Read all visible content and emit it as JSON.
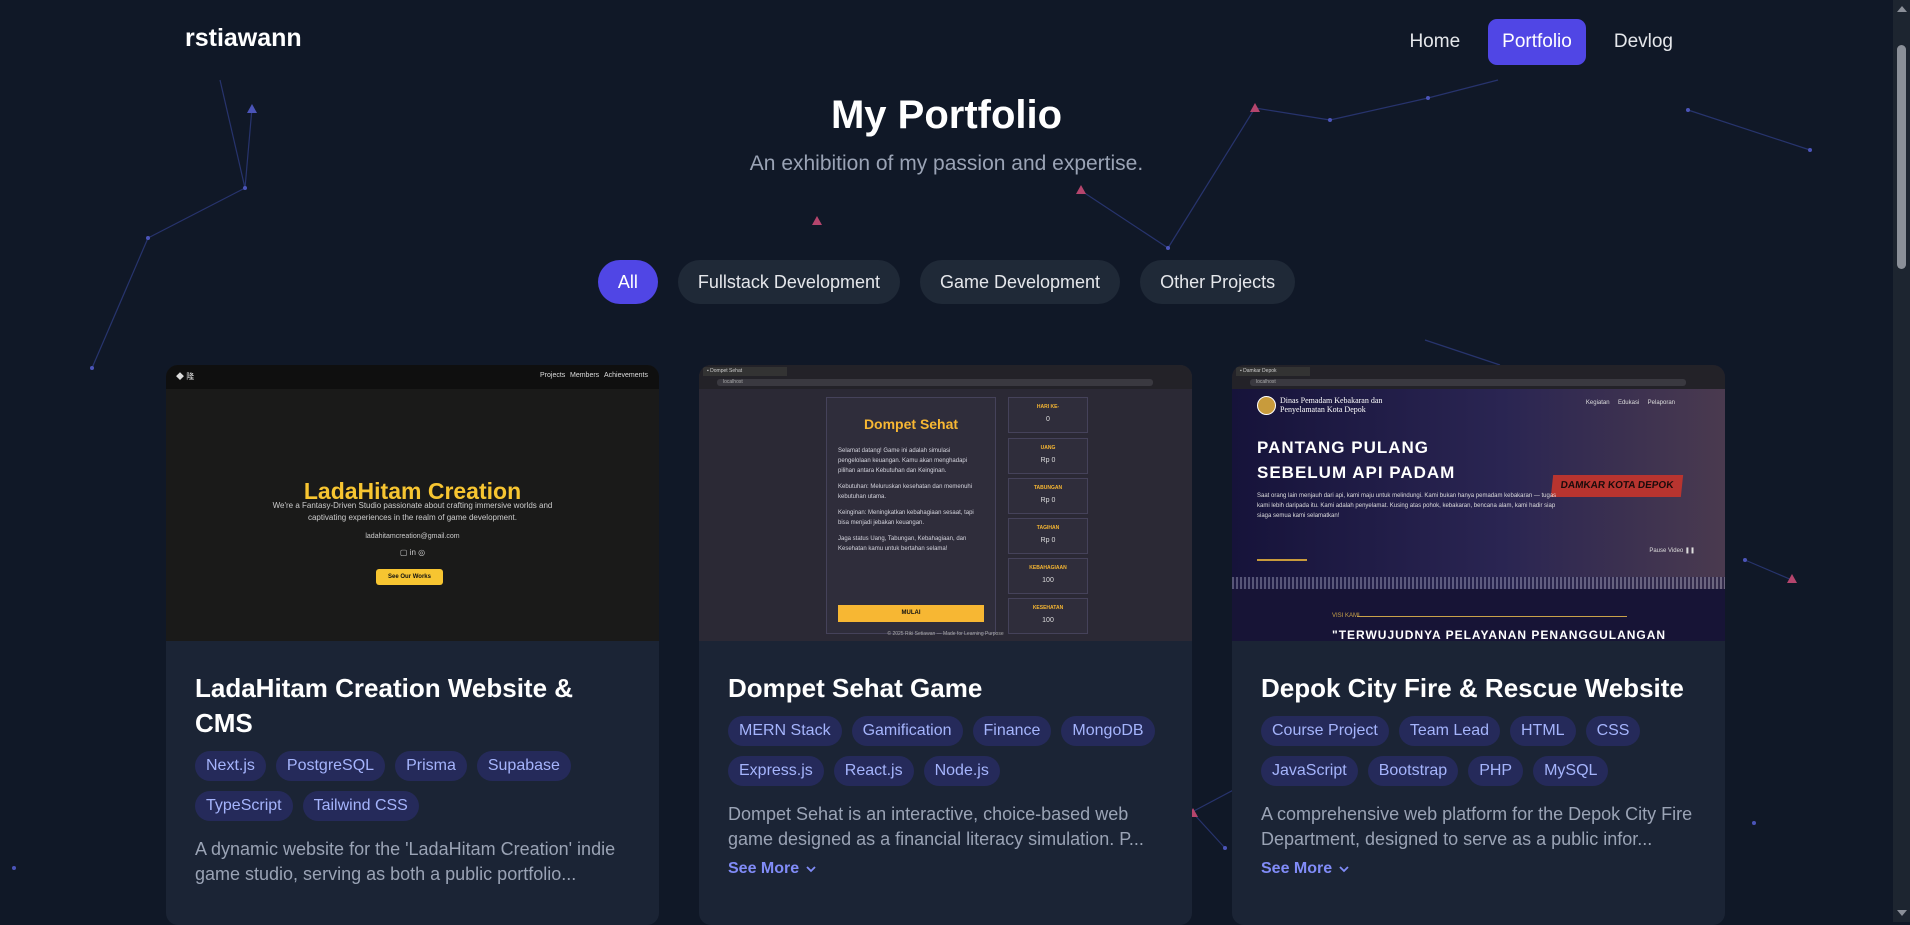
{
  "brand": "rstiawann",
  "nav": {
    "items": [
      "Home",
      "Portfolio",
      "Devlog"
    ],
    "active": "Portfolio"
  },
  "hero": {
    "title": "My Portfolio",
    "subtitle": "An exhibition of my passion and expertise."
  },
  "filters": [
    "All",
    "Fullstack Development",
    "Game Development",
    "Other Projects"
  ],
  "colors": {
    "accent": "#5046e5",
    "background": "#101827",
    "card": "#1b2435",
    "tag_text": "#a5b4fc",
    "link": "#818cf8"
  },
  "cards": [
    {
      "title": "LadaHitam Creation Website & CMS",
      "tags": [
        "Next.js",
        "PostgreSQL",
        "Prisma",
        "Supabase",
        "TypeScript",
        "Tailwind CSS"
      ],
      "description": "A dynamic website for the 'LadaHitam Creation' indie game studio, serving as both a public portfolio...",
      "preview": {
        "nav_links": [
          "Projects",
          "Members",
          "Achievements"
        ],
        "heading": "LadaHitam Creation",
        "text": "We're a Fantasy-Driven Studio passionate about crafting immersive worlds and captivating experiences in the realm of game development.",
        "email": "ladahitamcreation@gmail.com",
        "social": "in",
        "button": "See Our Works"
      }
    },
    {
      "title": "Dompet Sehat Game",
      "tags": [
        "MERN Stack",
        "Gamification",
        "Finance",
        "MongoDB",
        "Express.js",
        "React.js",
        "Node.js"
      ],
      "description": "Dompet Sehat is an interactive, choice-based web game designed as a financial literacy simulation. P...",
      "see_more": "See More",
      "preview": {
        "heading": "Dompet Sehat",
        "paragraphs": [
          "Selamat datang! Game ini adalah simulasi pengelolaan keuangan. Kamu akan menghadapi pilihan antara Kebutuhan dan Keinginan.",
          "Kebutuhan: Meluruskan kesehatan dan memenuhi kebutuhan utama.",
          "Keinginan: Meningkatkan kebahagiaan sesaat, tapi bisa menjadi jebakan keuangan.",
          "Jaga status Uang, Tabungan, Kebahagiaan, dan Kesehatan kamu untuk bertahan selama!"
        ],
        "button": "MULAI",
        "stats": [
          {
            "label": "HARI KE-",
            "value": "0"
          },
          {
            "label": "UANG",
            "value": "Rp 0"
          },
          {
            "label": "TABUNGAN",
            "value": "Rp 0"
          },
          {
            "label": "TAGIHAN",
            "value": "Rp 0"
          },
          {
            "label": "KEBAHAGIAAN",
            "value": "100"
          },
          {
            "label": "KESEHATAN",
            "value": "100"
          }
        ],
        "footer": "© 2025 Riki Setiawan — Made for Learning Purpose"
      }
    },
    {
      "title": "Depok City Fire & Rescue Website",
      "tags": [
        "Course Project",
        "Team Lead",
        "HTML",
        "CSS",
        "JavaScript",
        "Bootstrap",
        "PHP",
        "MySQL"
      ],
      "description": "A comprehensive web platform for the Depok City Fire Department, designed to serve as a public infor...",
      "see_more": "See More",
      "preview": {
        "brand": [
          "Dinas Pemadam Kebakaran dan",
          "Penyelamatan Kota Depok"
        ],
        "nav_links": [
          "Kegiatan",
          "Edukasi",
          "Pelaporan"
        ],
        "headline": [
          "PANTANG PULANG",
          "SEBELUM API PADAM"
        ],
        "text": "Saat orang lain menjauh dari api, kami maju untuk melindungi. Kami bukan hanya pemadam kebakaran — tugas kami lebih daripada itu. Kami adalah penyelamat. Kusing atas pohok, kebakaran, bencana alam, kami hadir siap siaga semua kami selamatkan!",
        "truck_text": "DAMKAR KOTA DEPOK",
        "play": "Pause Video",
        "visi_label": "VISI KAMI",
        "visi_text": "\"TERWUJUDNYA PELAYANAN PENANGGULANGAN"
      }
    }
  ]
}
